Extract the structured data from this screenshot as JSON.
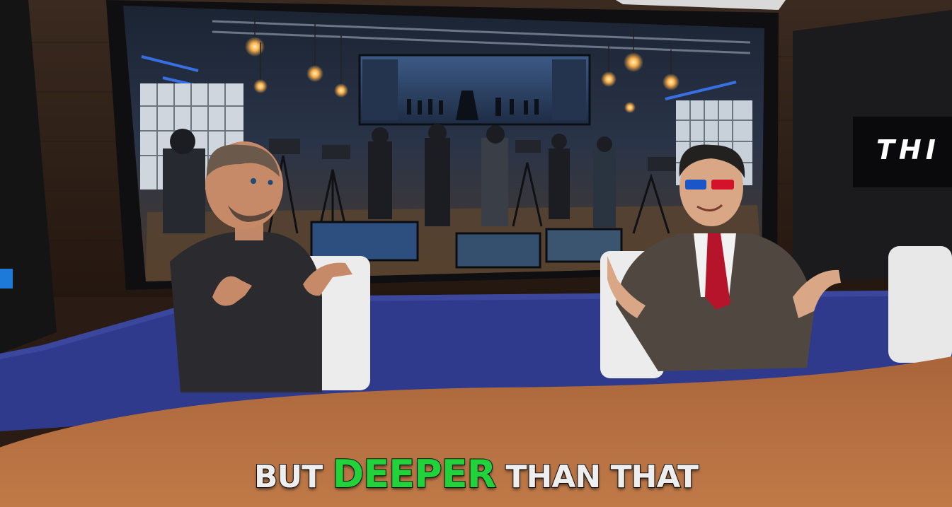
{
  "studio": {
    "logo_text": "THI"
  },
  "caption": {
    "word1": "BUT",
    "highlight": "DEEPER",
    "word3": "THAN THAT",
    "highlight_color": "#22d23a",
    "text_color": "#eeeeee"
  },
  "colors": {
    "back_wall": "#2e2018",
    "desk": "#b06a3c",
    "desk_panel": "#2f3a8c"
  }
}
